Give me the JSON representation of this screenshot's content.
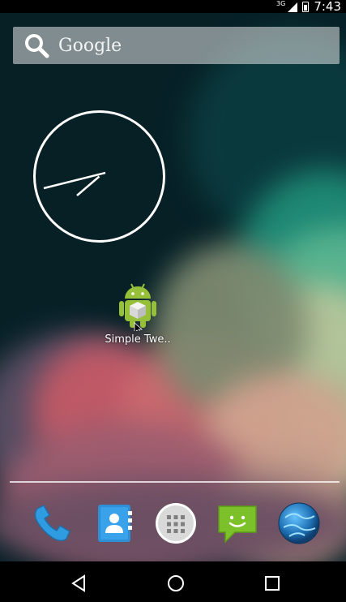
{
  "status_bar": {
    "network": "3G",
    "time": "7:43"
  },
  "search_widget": {
    "label": "Google"
  },
  "home_apps": [
    {
      "label": "Simple Twe..",
      "icon": "android-app-icon"
    }
  ],
  "dock": {
    "items": [
      {
        "name": "phone",
        "icon": "phone-icon"
      },
      {
        "name": "contacts",
        "icon": "contacts-icon"
      },
      {
        "name": "app-drawer",
        "icon": "app-drawer-icon"
      },
      {
        "name": "messaging",
        "icon": "messaging-icon"
      },
      {
        "name": "browser",
        "icon": "browser-globe-icon"
      }
    ]
  },
  "navigation": {
    "buttons": [
      "back",
      "home",
      "recents"
    ]
  },
  "colors": {
    "status_bar": "#000000",
    "nav_bar": "#000000",
    "wallpaper_base": "#062026",
    "android_green": "#97c03a"
  }
}
